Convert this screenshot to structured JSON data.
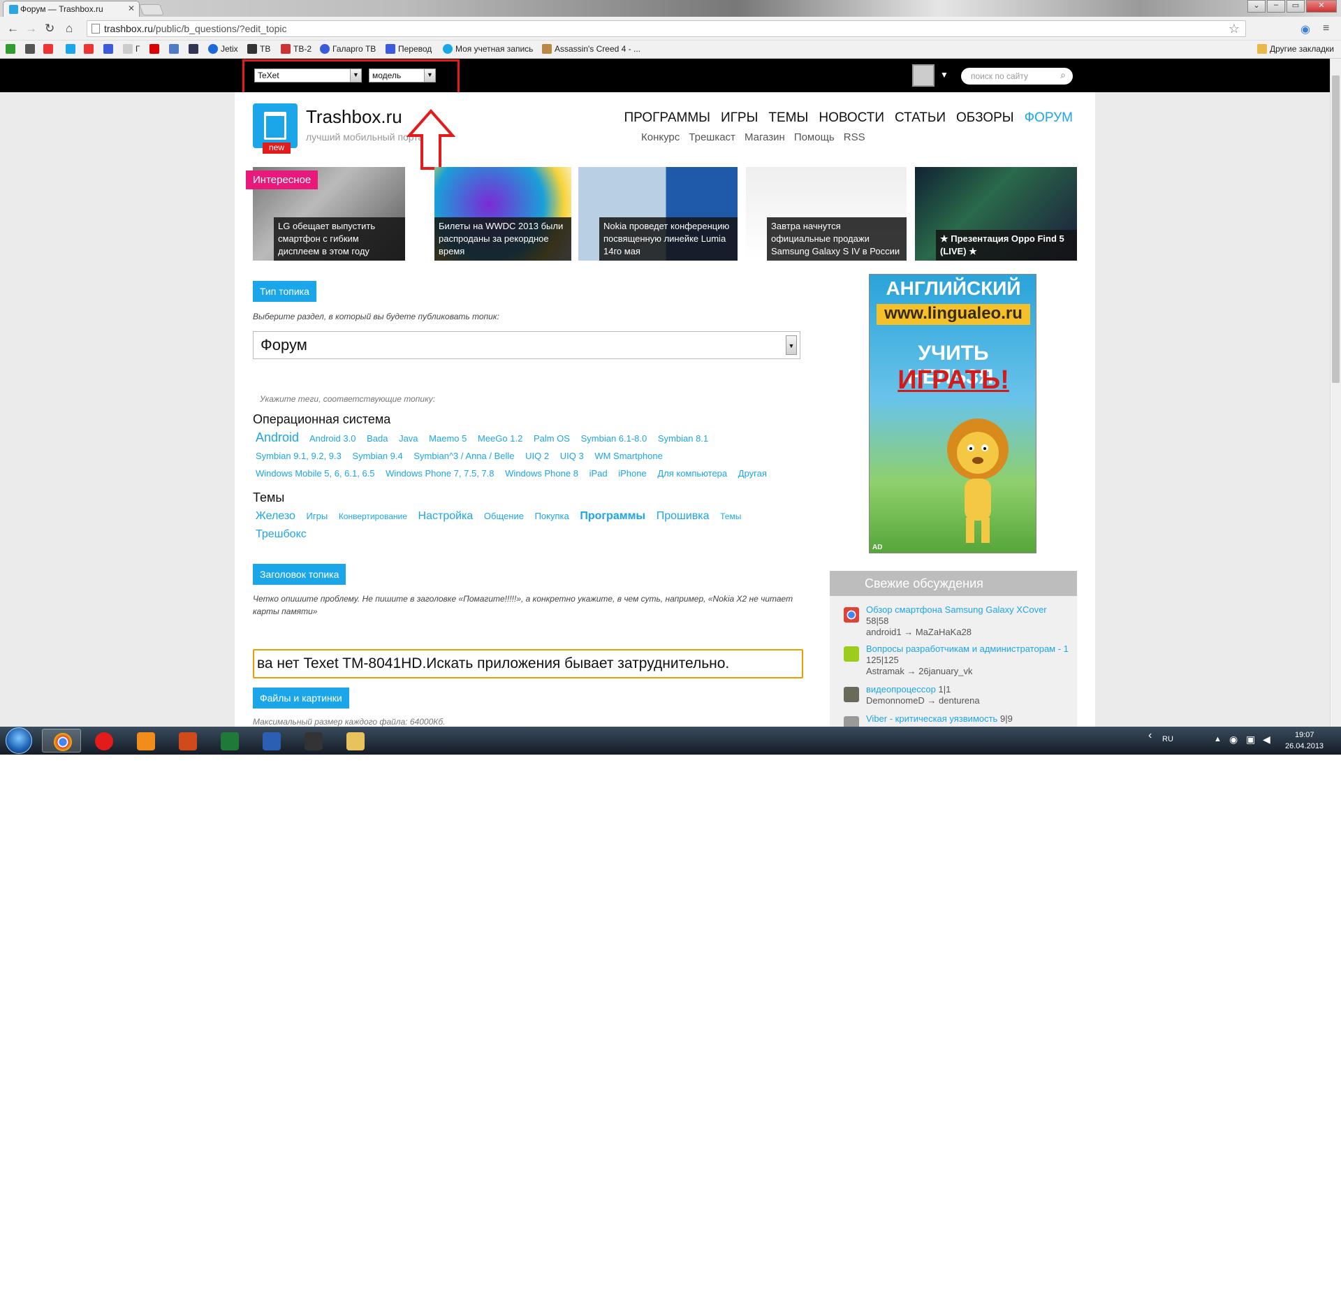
{
  "browser": {
    "tab_title": "Форум — Trashbox.ru",
    "url_host": "trashbox.ru",
    "url_path": "/public/b_questions/?edit_topic",
    "bookmarks": [
      "Г",
      "Jetix",
      "ТВ",
      "ТВ-2",
      "Галарго ТВ",
      "Перевод",
      "Моя учетная запись",
      "Assassin's Creed 4 - ..."
    ],
    "other_bookmarks": "Другие закладки"
  },
  "topbar": {
    "brand_select": "TeXet",
    "model_select": "модель",
    "search_placeholder": "поиск по сайту"
  },
  "header": {
    "logo_title": "Trashbox.ru",
    "logo_subtitle": "лучший мобильный портал",
    "logo_badge": "new",
    "nav": [
      "ПРОГРАММЫ",
      "ИГРЫ",
      "ТЕМЫ",
      "НОВОСТИ",
      "СТАТЬИ",
      "ОБЗОРЫ",
      "ФОРУМ"
    ],
    "subnav": [
      "Конкурс",
      "Трешкаст",
      "Магазин",
      "Помощь",
      "RSS"
    ]
  },
  "featured": {
    "badge": "Интересное",
    "cards": [
      {
        "caption": "LG обещает выпустить смартфон с гибким дисплеем в этом году"
      },
      {
        "caption": "Билеты на WWDC 2013 были распроданы за рекордное время"
      },
      {
        "caption": "Nokia проведет конференцию посвященную линейке Lumia 14го мая"
      },
      {
        "caption": "Завтра начнутся официальные продажи Samsung Galaxy S IV в России"
      },
      {
        "caption": "★ Презентация Oppo Find 5 (LIVE) ★"
      }
    ]
  },
  "form": {
    "type_label": "Тип топика",
    "type_hint": "Выберите раздел, в который вы будете публиковать топик:",
    "type_value": "Форум",
    "tags_hint": "Укажите теги, соответствующие топику:",
    "os_title": "Операционная система",
    "os_tags": [
      "Android",
      "Android 3.0",
      "Bada",
      "Java",
      "Maemo 5",
      "MeeGo 1.2",
      "Palm OS",
      "Symbian 6.1-8.0",
      "Symbian 8.1",
      "Symbian 9.1, 9.2, 9.3",
      "Symbian 9.4",
      "Symbian^3 / Anna / Belle",
      "UIQ 2",
      "UIQ 3",
      "WM Smartphone",
      "Windows Mobile 5, 6, 6.1, 6.5",
      "Windows Phone 7, 7.5, 7.8",
      "Windows Phone 8",
      "iPad",
      "iPhone",
      "Для компьютера",
      "Другая"
    ],
    "themes_title": "Темы",
    "theme_tags": [
      "Железо",
      "Игры",
      "Конвертирование",
      "Настройка",
      "Общение",
      "Покупка",
      "Программы",
      "Прошивка",
      "Темы",
      "Трешбокс"
    ],
    "title_label": "Заголовок топика",
    "title_hint": "Четко опишите проблему. Не пишите в заголовке «Помагите!!!!!», а конкретно укажите, в чем суть, например, «Nokia X2 не читает карты памяти»",
    "title_value": "ва нет Texet TM-8041HD.Искать приложения бывает затруднительно.",
    "files_label": "Файлы и картинки",
    "files_hint": "Максимальный размер каждого файла: 64000Кб."
  },
  "ad": {
    "line1": "АНГЛИЙСКИЙ НА",
    "line2": "www.lingualeo.ru",
    "line3": "УЧИТЬ НЕЛЬЗЯ,",
    "line4": "ИГРАТЬ!",
    "corner": "AD"
  },
  "fresh": {
    "title": "Свежие обсуждения",
    "items": [
      {
        "link": "Обзор смартфона Samsung Galaxy XCover",
        "count": "58|58",
        "users": "android1 → MaZaHaKa28"
      },
      {
        "link": "Вопросы разработчикам и администраторам - 1",
        "count": "125|125",
        "users": "Astramak → 26january_vk"
      },
      {
        "link": "видеопроцессор",
        "count": "1|1",
        "users": "DemonnomeD → denturena"
      },
      {
        "link": "Viber - критическая уязвимость",
        "count": "9|9",
        "users": ""
      }
    ]
  },
  "taskbar": {
    "lang": "RU",
    "time": "19:07",
    "date": "26.04.2013"
  }
}
